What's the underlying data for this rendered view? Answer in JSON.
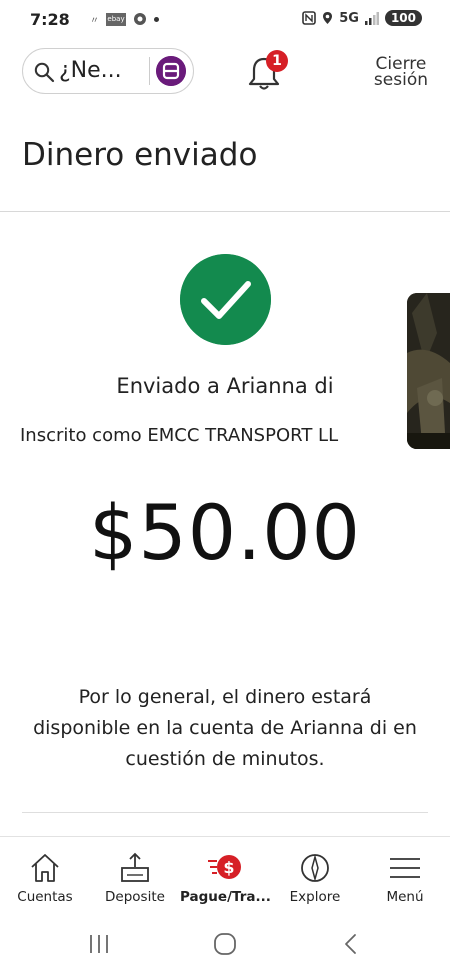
{
  "status_bar": {
    "time": "7:28",
    "left_icons": [
      "notification-icon",
      "ebay-icon",
      "chrome-icon",
      "dot-icon"
    ],
    "network": "5G",
    "battery": "100"
  },
  "header": {
    "search_text": "¿Ne...",
    "notification_count": "1",
    "signout_line1": "Cierre",
    "signout_line2": "sesión",
    "accent_color": "#d61f26",
    "ai_color": "#6a1b7b"
  },
  "page": {
    "title": "Dinero enviado",
    "sent_to": "Enviado a Arianna di",
    "enrolled_as": "Inscrito como EMCC TRANSPORT LL",
    "amount": "$50.00",
    "info": "Por lo general, el dinero estará disponible en la cuenta de Arianna di en cuestión de minutos.",
    "success_color": "#138a4e"
  },
  "bottom_nav": {
    "items": [
      {
        "label": "Cuentas",
        "icon": "home-icon"
      },
      {
        "label": "Deposite",
        "icon": "deposit-icon"
      },
      {
        "label": "Pague/Tra...",
        "icon": "pay-transfer-icon",
        "active": true
      },
      {
        "label": "Explore",
        "icon": "compass-icon"
      },
      {
        "label": "Menú",
        "icon": "menu-icon"
      }
    ]
  },
  "system_nav": [
    "recents-button",
    "home-button",
    "back-button"
  ]
}
